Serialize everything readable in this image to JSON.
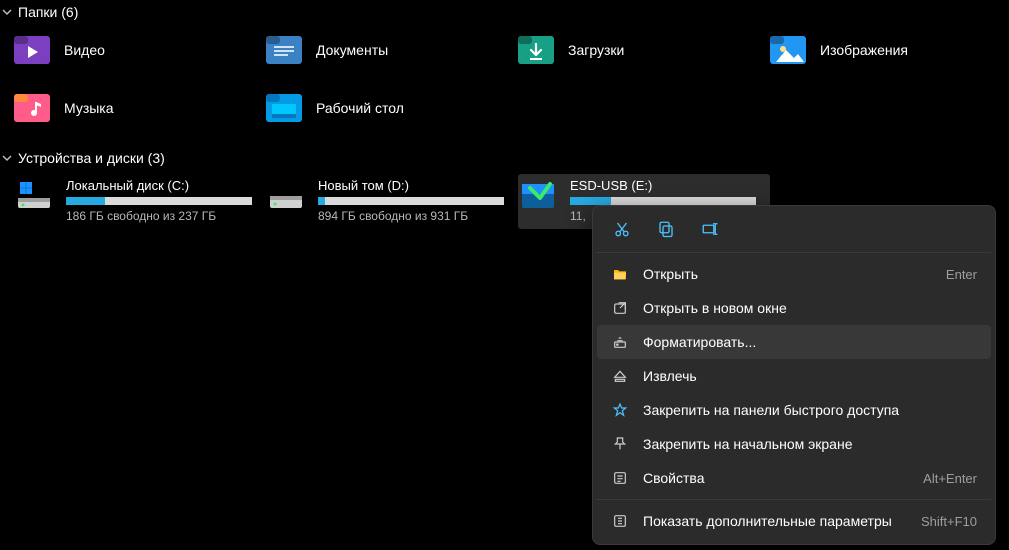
{
  "sections": {
    "folders_header": "Папки (6)",
    "drives_header": "Устройства и диски (3)"
  },
  "folders": [
    {
      "label": "Видео"
    },
    {
      "label": "Документы"
    },
    {
      "label": "Загрузки"
    },
    {
      "label": "Изображения"
    },
    {
      "label": "Музыка"
    },
    {
      "label": "Рабочий стол"
    }
  ],
  "drives": [
    {
      "name": "Локальный диск (C:)",
      "subtitle": "186 ГБ свободно из 237 ГБ",
      "fill_percent": 21,
      "type": "system"
    },
    {
      "name": "Новый том (D:)",
      "subtitle": "894 ГБ свободно из 931 ГБ",
      "fill_percent": 4,
      "type": "hdd"
    },
    {
      "name": "ESD-USB (E:)",
      "subtitle": "11,",
      "fill_percent": 22,
      "type": "usb",
      "selected": true
    }
  ],
  "context_menu": {
    "items": [
      {
        "icon": "open-folder-icon",
        "label": "Открыть",
        "shortcut": "Enter"
      },
      {
        "icon": "open-new-window-icon",
        "label": "Открыть в новом окне",
        "shortcut": ""
      },
      {
        "icon": "format-drive-icon",
        "label": "Форматировать...",
        "shortcut": "",
        "hover": true
      },
      {
        "icon": "eject-icon",
        "label": "Извлечь",
        "shortcut": ""
      },
      {
        "icon": "pin-quick-access-icon",
        "label": "Закрепить на панели быстрого доступа",
        "shortcut": ""
      },
      {
        "icon": "pin-start-icon",
        "label": "Закрепить на начальном экране",
        "shortcut": ""
      },
      {
        "icon": "properties-icon",
        "label": "Свойства",
        "shortcut": "Alt+Enter"
      },
      {
        "icon": "show-more-icon",
        "label": "Показать дополнительные параметры",
        "shortcut": "Shift+F10"
      }
    ]
  }
}
